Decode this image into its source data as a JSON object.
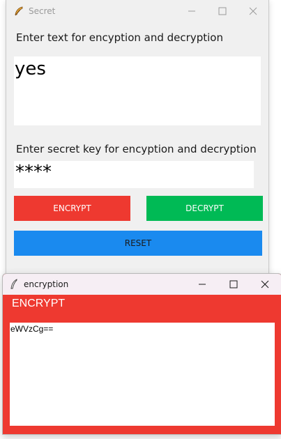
{
  "main_window": {
    "title": "Secret",
    "text_label": "Enter text for encyption and decryption",
    "text_value": "yes",
    "key_label": "Enter secret key for encyption and decryption",
    "key_value": "****",
    "encrypt_label": "ENCRYPT",
    "decrypt_label": "DECRYPT",
    "reset_label": "RESET"
  },
  "popup_window": {
    "title": "encryption",
    "heading": "ENCRYPT",
    "output_text": "eWVzCg=="
  },
  "colors": {
    "encrypt": "#ee3930",
    "decrypt": "#00ba55",
    "reset": "#1a8aef",
    "window_bg": "#f0f0f0"
  },
  "icons": {
    "main_app": "feather-icon",
    "popup_app": "feather-icon",
    "minimize": "minimize-icon",
    "maximize": "maximize-icon",
    "close": "close-icon"
  }
}
